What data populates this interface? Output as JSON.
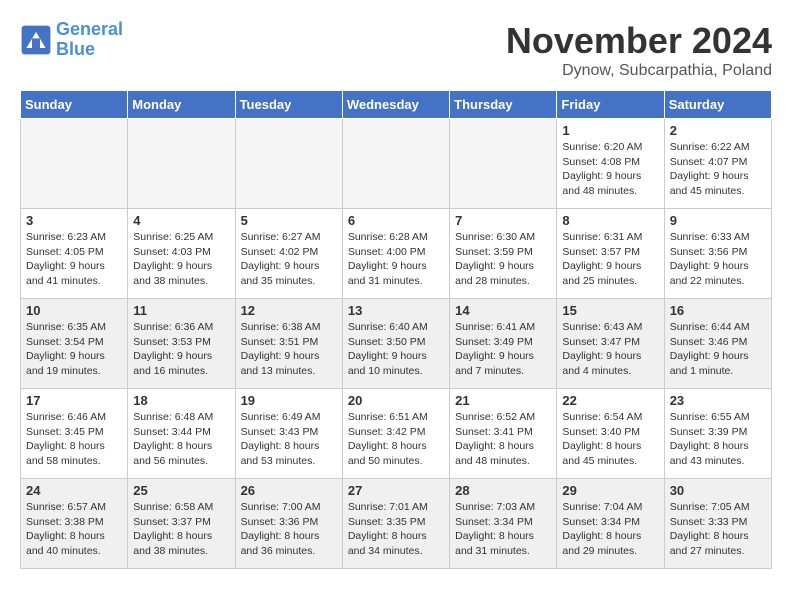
{
  "header": {
    "logo_line1": "General",
    "logo_line2": "Blue",
    "month": "November 2024",
    "location": "Dynow, Subcarpathia, Poland"
  },
  "days_of_week": [
    "Sunday",
    "Monday",
    "Tuesday",
    "Wednesday",
    "Thursday",
    "Friday",
    "Saturday"
  ],
  "weeks": [
    [
      {
        "day": "",
        "info": ""
      },
      {
        "day": "",
        "info": ""
      },
      {
        "day": "",
        "info": ""
      },
      {
        "day": "",
        "info": ""
      },
      {
        "day": "",
        "info": ""
      },
      {
        "day": "1",
        "info": "Sunrise: 6:20 AM\nSunset: 4:08 PM\nDaylight: 9 hours\nand 48 minutes."
      },
      {
        "day": "2",
        "info": "Sunrise: 6:22 AM\nSunset: 4:07 PM\nDaylight: 9 hours\nand 45 minutes."
      }
    ],
    [
      {
        "day": "3",
        "info": "Sunrise: 6:23 AM\nSunset: 4:05 PM\nDaylight: 9 hours\nand 41 minutes."
      },
      {
        "day": "4",
        "info": "Sunrise: 6:25 AM\nSunset: 4:03 PM\nDaylight: 9 hours\nand 38 minutes."
      },
      {
        "day": "5",
        "info": "Sunrise: 6:27 AM\nSunset: 4:02 PM\nDaylight: 9 hours\nand 35 minutes."
      },
      {
        "day": "6",
        "info": "Sunrise: 6:28 AM\nSunset: 4:00 PM\nDaylight: 9 hours\nand 31 minutes."
      },
      {
        "day": "7",
        "info": "Sunrise: 6:30 AM\nSunset: 3:59 PM\nDaylight: 9 hours\nand 28 minutes."
      },
      {
        "day": "8",
        "info": "Sunrise: 6:31 AM\nSunset: 3:57 PM\nDaylight: 9 hours\nand 25 minutes."
      },
      {
        "day": "9",
        "info": "Sunrise: 6:33 AM\nSunset: 3:56 PM\nDaylight: 9 hours\nand 22 minutes."
      }
    ],
    [
      {
        "day": "10",
        "info": "Sunrise: 6:35 AM\nSunset: 3:54 PM\nDaylight: 9 hours\nand 19 minutes."
      },
      {
        "day": "11",
        "info": "Sunrise: 6:36 AM\nSunset: 3:53 PM\nDaylight: 9 hours\nand 16 minutes."
      },
      {
        "day": "12",
        "info": "Sunrise: 6:38 AM\nSunset: 3:51 PM\nDaylight: 9 hours\nand 13 minutes."
      },
      {
        "day": "13",
        "info": "Sunrise: 6:40 AM\nSunset: 3:50 PM\nDaylight: 9 hours\nand 10 minutes."
      },
      {
        "day": "14",
        "info": "Sunrise: 6:41 AM\nSunset: 3:49 PM\nDaylight: 9 hours\nand 7 minutes."
      },
      {
        "day": "15",
        "info": "Sunrise: 6:43 AM\nSunset: 3:47 PM\nDaylight: 9 hours\nand 4 minutes."
      },
      {
        "day": "16",
        "info": "Sunrise: 6:44 AM\nSunset: 3:46 PM\nDaylight: 9 hours\nand 1 minute."
      }
    ],
    [
      {
        "day": "17",
        "info": "Sunrise: 6:46 AM\nSunset: 3:45 PM\nDaylight: 8 hours\nand 58 minutes."
      },
      {
        "day": "18",
        "info": "Sunrise: 6:48 AM\nSunset: 3:44 PM\nDaylight: 8 hours\nand 56 minutes."
      },
      {
        "day": "19",
        "info": "Sunrise: 6:49 AM\nSunset: 3:43 PM\nDaylight: 8 hours\nand 53 minutes."
      },
      {
        "day": "20",
        "info": "Sunrise: 6:51 AM\nSunset: 3:42 PM\nDaylight: 8 hours\nand 50 minutes."
      },
      {
        "day": "21",
        "info": "Sunrise: 6:52 AM\nSunset: 3:41 PM\nDaylight: 8 hours\nand 48 minutes."
      },
      {
        "day": "22",
        "info": "Sunrise: 6:54 AM\nSunset: 3:40 PM\nDaylight: 8 hours\nand 45 minutes."
      },
      {
        "day": "23",
        "info": "Sunrise: 6:55 AM\nSunset: 3:39 PM\nDaylight: 8 hours\nand 43 minutes."
      }
    ],
    [
      {
        "day": "24",
        "info": "Sunrise: 6:57 AM\nSunset: 3:38 PM\nDaylight: 8 hours\nand 40 minutes."
      },
      {
        "day": "25",
        "info": "Sunrise: 6:58 AM\nSunset: 3:37 PM\nDaylight: 8 hours\nand 38 minutes."
      },
      {
        "day": "26",
        "info": "Sunrise: 7:00 AM\nSunset: 3:36 PM\nDaylight: 8 hours\nand 36 minutes."
      },
      {
        "day": "27",
        "info": "Sunrise: 7:01 AM\nSunset: 3:35 PM\nDaylight: 8 hours\nand 34 minutes."
      },
      {
        "day": "28",
        "info": "Sunrise: 7:03 AM\nSunset: 3:34 PM\nDaylight: 8 hours\nand 31 minutes."
      },
      {
        "day": "29",
        "info": "Sunrise: 7:04 AM\nSunset: 3:34 PM\nDaylight: 8 hours\nand 29 minutes."
      },
      {
        "day": "30",
        "info": "Sunrise: 7:05 AM\nSunset: 3:33 PM\nDaylight: 8 hours\nand 27 minutes."
      }
    ]
  ]
}
